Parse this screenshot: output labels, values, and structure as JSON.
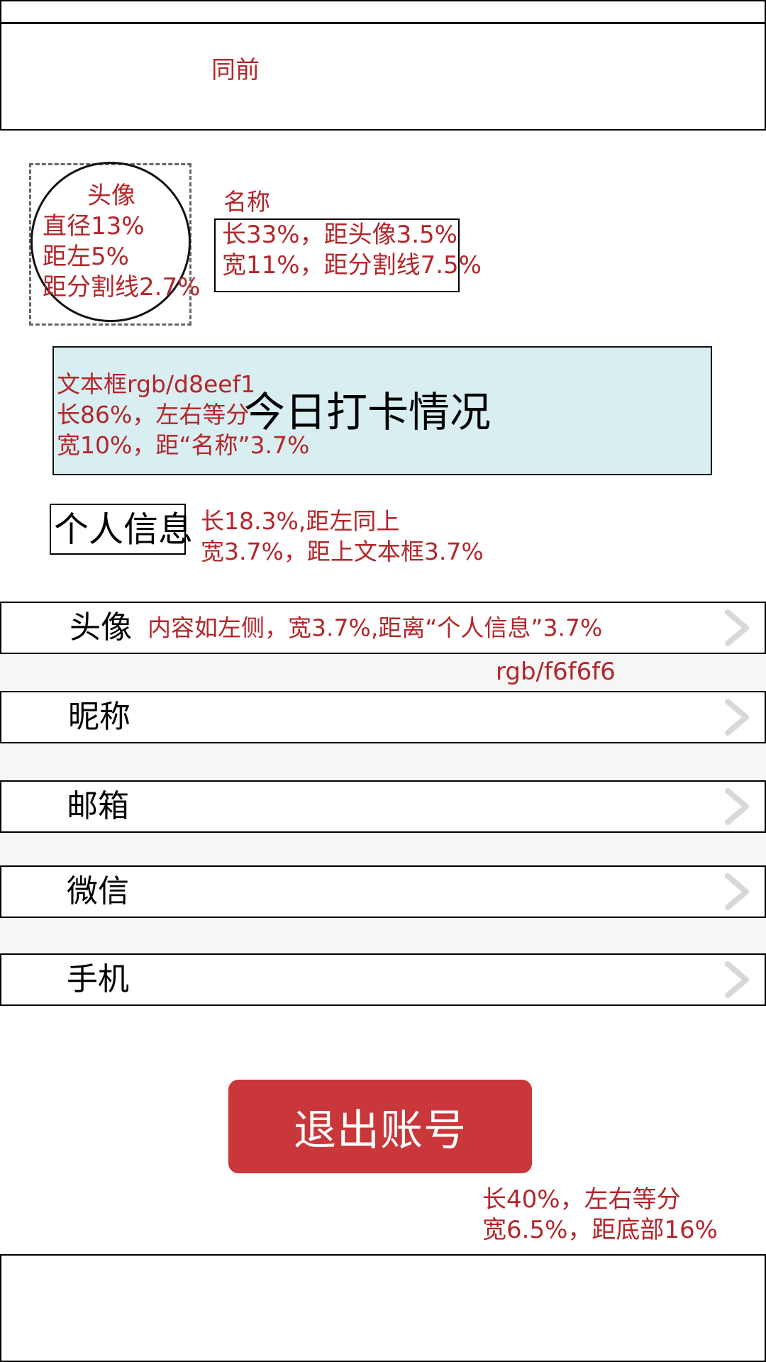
{
  "header": {
    "note": "同前"
  },
  "avatar": {
    "note_lines": [
      "头像",
      "直径13%",
      "距左5%",
      "距分割线2.7%"
    ]
  },
  "name": {
    "label": "名称",
    "note_lines": [
      "长33%，距头像3.5%",
      "宽11%，距分割线7.5%"
    ]
  },
  "checkin": {
    "title": "今日打卡情况",
    "note_lines": [
      "文本框rgb/d8eef1",
      "长86%，左右等分",
      "宽10%，距“名称”3.7%"
    ]
  },
  "section": {
    "title": "个人信息",
    "note_lines": [
      "长18.3%,距左同上",
      "宽3.7%，距上文本框3.7%"
    ]
  },
  "rows": [
    {
      "label": "头像",
      "note": "内容如左侧，宽3.7%,距离“个人信息”3.7%"
    },
    {
      "label": "昵称"
    },
    {
      "label": "邮箱"
    },
    {
      "label": "微信"
    },
    {
      "label": "手机"
    }
  ],
  "gap_note": "rgb/f6f6f6",
  "logout": {
    "label": "退出账号",
    "note_lines": [
      "长40%，左右等分",
      "宽6.5%，距底部16%"
    ]
  },
  "colors": {
    "annotation": "#b3262a",
    "checkin_bg": "#d8eef1",
    "gap_bg": "#f6f6f6",
    "logout_bg": "#c9373a",
    "chevron": "#d8d8d8"
  }
}
